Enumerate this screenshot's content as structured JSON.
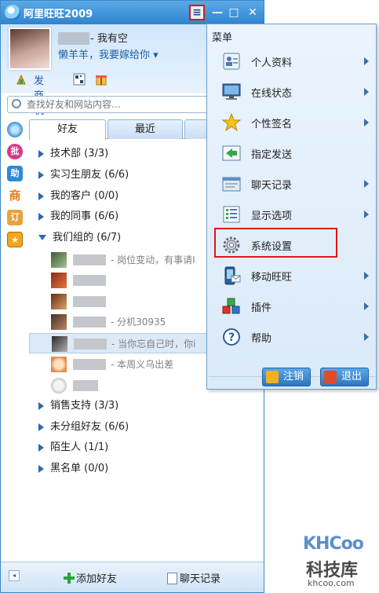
{
  "app": {
    "title": "阿里旺旺2009"
  },
  "titlebar": {
    "menu_glyph": "≡",
    "minimize_glyph": "—",
    "maximize_glyph": "□",
    "close_glyph": "✕"
  },
  "profile": {
    "status": "- 我有空",
    "signature": "懒羊羊，我要嫁给你 ▾"
  },
  "toolbar": {
    "send_business_label": "发商机"
  },
  "search": {
    "placeholder": "查找好友和网站内容…"
  },
  "tabs": [
    {
      "label": "好友"
    },
    {
      "label": "最近"
    }
  ],
  "groups": [
    {
      "label": "技术部 (3/3)",
      "expanded": false
    },
    {
      "label": "实习生朋友 (6/6)",
      "expanded": false
    },
    {
      "label": "我的客户 (0/0)",
      "expanded": false
    },
    {
      "label": "我的同事 (6/6)",
      "expanded": false
    },
    {
      "label": "我们组的 (6/7)",
      "expanded": true
    },
    {
      "label": "销售支持 (3/3)",
      "expanded": false
    },
    {
      "label": "未分组好友 (6/6)",
      "expanded": false
    },
    {
      "label": "陌生人 (1/1)",
      "expanded": false
    },
    {
      "label": "黑名单 (0/0)",
      "expanded": false
    }
  ],
  "friends": [
    {
      "note": "- 岗位变动，有事请I"
    },
    {
      "note": ""
    },
    {
      "note": ""
    },
    {
      "note": "- 分机30935"
    },
    {
      "note": "- 当你忘自己时，你i"
    },
    {
      "note": "- 本周义乌出差"
    },
    {
      "note": ""
    }
  ],
  "bottom": {
    "add_friend_label": "添加好友",
    "chat_history_label": "聊天记录"
  },
  "menu": {
    "header": "菜单",
    "items": [
      {
        "label": "个人资料",
        "icon": "profile-card-icon",
        "has_submenu": true
      },
      {
        "label": "在线状态",
        "icon": "monitor-icon",
        "has_submenu": true
      },
      {
        "label": "个性签名",
        "icon": "star-icon",
        "has_submenu": true
      },
      {
        "label": "指定发送",
        "icon": "send-arrow-icon",
        "has_submenu": false
      },
      {
        "label": "聊天记录",
        "icon": "folder-icon",
        "has_submenu": true
      },
      {
        "label": "显示选项",
        "icon": "checklist-icon",
        "has_submenu": true
      },
      {
        "label": "系统设置",
        "icon": "gear-icon",
        "has_submenu": false
      },
      {
        "label": "移动旺旺",
        "icon": "mobile-phone-icon",
        "has_submenu": true
      },
      {
        "label": "插件",
        "icon": "plugin-cubes-icon",
        "has_submenu": true
      },
      {
        "label": "帮助",
        "icon": "help-icon",
        "has_submenu": true
      }
    ],
    "logout_label": "注销",
    "exit_label": "退出"
  },
  "watermark": {
    "logo": "KHCoo",
    "name": "科技库",
    "url": "khcoo.com"
  },
  "colors": {
    "titlebar": "#2f84cf",
    "highlight_border": "#e0141b",
    "menu_bg": "#e2eefa",
    "link_blue": "#1f5fa5"
  }
}
